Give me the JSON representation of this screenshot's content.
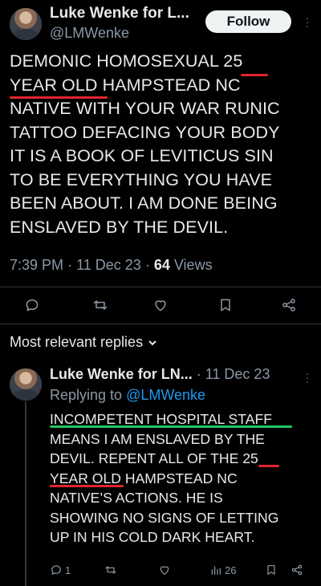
{
  "tweet": {
    "author_name": "Luke Wenke for L...",
    "author_handle": "@LMWenke",
    "follow_label": "Follow",
    "text": "DEMONIC HOMOSEXUAL 25\nYEAR OLD HAMPSTEAD NC\nNATIVE WITH YOUR WAR RUNIC\nTATTOO DEFACING YOUR BODY\nIT IS A BOOK OF LEVITICUS SIN\nTO BE EVERYTHING YOU HAVE\nBEEN ABOUT.  I AM DONE BEING\nENSLAVED BY THE DEVIL.",
    "time": "7:39 PM",
    "date": "11 Dec 23",
    "views_count": "64",
    "views_label": "Views",
    "separator": "·"
  },
  "actions": {
    "icons": [
      "reply-icon",
      "retweet-icon",
      "like-icon",
      "bookmark-icon",
      "share-icon"
    ]
  },
  "replies_section": {
    "sort_label": "Most relevant replies"
  },
  "reply": {
    "author_name": "Luke Wenke for LN...",
    "separator": "·",
    "date": "11 Dec 23",
    "replying_prefix": "Replying to",
    "replying_mention": "@LMWenke",
    "text": "INCOMPETENT HOSPITAL STAFF\nMEANS I AM ENSLAVED BY THE\nDEVIL.  REPENT ALL OF THE 25\nYEAR OLD HAMPSTEAD NC\nNATIVE’S ACTIONS.  HE IS\nSHOWING NO SIGNS OF LETTING\nUP IN HIS COLD DARK HEART.",
    "reply_count": "1",
    "views_count": "26"
  },
  "colors": {
    "background": "#000000",
    "text": "#e7e9ea",
    "muted": "#8b98a5",
    "link": "#1d9bf0",
    "annotation_red": "#e0252b",
    "annotation_green": "#22c55e"
  }
}
